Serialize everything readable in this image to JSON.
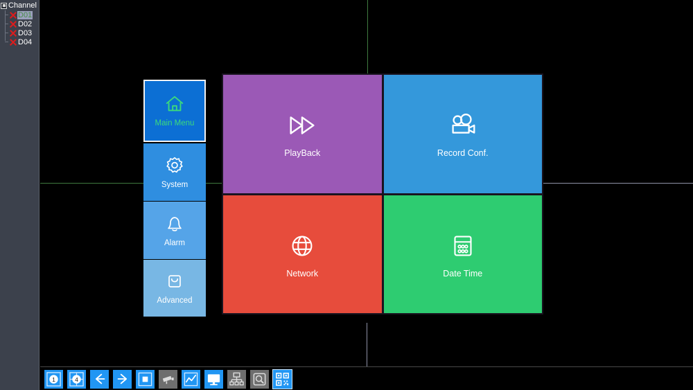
{
  "window": {
    "background_color": "#000000",
    "accent_color": "#2196f3",
    "selection_green": "#3ddb7b"
  },
  "channel_panel": {
    "root_label": "Channel",
    "root_icon": "minus-box-icon",
    "background_color": "#3c414c",
    "items": [
      {
        "label": "D01",
        "status_icon": "red-x-icon",
        "selected": true
      },
      {
        "label": "D02",
        "status_icon": "red-x-icon",
        "selected": false
      },
      {
        "label": "D03",
        "status_icon": "red-x-icon",
        "selected": false
      },
      {
        "label": "D04",
        "status_icon": "red-x-icon",
        "selected": false
      }
    ]
  },
  "side_menu": {
    "items": [
      {
        "label": "Main Menu",
        "icon": "home-icon",
        "color": "#0c6fd4",
        "selected": true
      },
      {
        "label": "System",
        "icon": "gear-icon",
        "color": "#2f8ee0",
        "selected": false
      },
      {
        "label": "Alarm",
        "icon": "bell-icon",
        "color": "#55a4e8",
        "selected": false
      },
      {
        "label": "Advanced",
        "icon": "toolbox-icon",
        "color": "#78b7e4",
        "selected": false
      }
    ]
  },
  "tiles": [
    {
      "label": "PlayBack",
      "icon": "fast-forward-icon",
      "color": "#9b59b6"
    },
    {
      "label": "Record Conf.",
      "icon": "video-camera-icon",
      "color": "#3498db"
    },
    {
      "label": "Network",
      "icon": "globe-icon",
      "color": "#e74c3c"
    },
    {
      "label": "Date Time",
      "icon": "calendar-icon",
      "color": "#2ecc71"
    }
  ],
  "toolbar": {
    "buttons": [
      {
        "name": "single-view-button",
        "icon": "circle-1-icon",
        "state": "active"
      },
      {
        "name": "quad-view-button",
        "icon": "circle-4-target-icon",
        "state": "active"
      },
      {
        "name": "prev-page-button",
        "icon": "arrow-left-icon",
        "state": "active"
      },
      {
        "name": "next-page-button",
        "icon": "arrow-right-icon",
        "state": "active"
      },
      {
        "name": "stop-button",
        "icon": "stop-square-icon",
        "state": "active"
      },
      {
        "name": "camera-button",
        "icon": "cctv-camera-icon",
        "state": "disabled"
      },
      {
        "name": "chart-button",
        "icon": "line-chart-icon",
        "state": "active"
      },
      {
        "name": "display-button",
        "icon": "monitor-icon",
        "state": "active"
      },
      {
        "name": "network-tree-button",
        "icon": "network-tree-icon",
        "state": "disabled"
      },
      {
        "name": "disk-search-button",
        "icon": "disk-search-icon",
        "state": "disabled"
      },
      {
        "name": "qrcode-button",
        "icon": "qr-code-icon",
        "state": "selected"
      }
    ]
  },
  "split_lines": {
    "top_vertical_color": "#3f7a3f",
    "left_horizontal_color": "#3f7a3f",
    "right_horizontal_color": "#8f93a8",
    "bottom_vertical_color": "#8f93a8"
  }
}
